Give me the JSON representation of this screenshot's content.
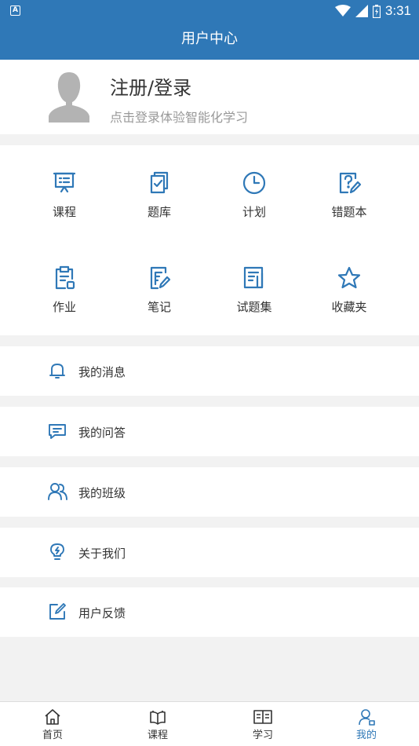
{
  "status_bar": {
    "time": "3:31",
    "left_icon_letter": "A"
  },
  "header": {
    "title": "用户中心"
  },
  "profile": {
    "login_label": "注册/登录",
    "hint": "点击登录体验智能化学习"
  },
  "grid": {
    "items": [
      {
        "label": "课程",
        "icon": "presentation-board-icon"
      },
      {
        "label": "题库",
        "icon": "question-bank-icon"
      },
      {
        "label": "计划",
        "icon": "clock-icon"
      },
      {
        "label": "错题本",
        "icon": "wrong-question-icon"
      },
      {
        "label": "作业",
        "icon": "clipboard-icon"
      },
      {
        "label": "笔记",
        "icon": "note-edit-icon"
      },
      {
        "label": "试题集",
        "icon": "test-collection-icon"
      },
      {
        "label": "收藏夹",
        "icon": "star-icon"
      }
    ]
  },
  "menu": {
    "items": [
      {
        "label": "我的消息",
        "icon": "bell-icon"
      },
      {
        "label": "我的问答",
        "icon": "chat-icon"
      },
      {
        "label": "我的班级",
        "icon": "users-icon"
      },
      {
        "label": "关于我们",
        "icon": "lightbulb-icon"
      },
      {
        "label": "用户反馈",
        "icon": "edit-icon"
      }
    ]
  },
  "tabbar": {
    "items": [
      {
        "label": "首页",
        "icon": "home-icon"
      },
      {
        "label": "课程",
        "icon": "book-open-icon"
      },
      {
        "label": "学习",
        "icon": "study-book-icon"
      },
      {
        "label": "我的",
        "icon": "user-icon"
      }
    ],
    "active_index": 3
  },
  "colors": {
    "primary": "#2f78b7",
    "background": "#f2f2f2",
    "text": "#333333",
    "hint": "#999999"
  }
}
